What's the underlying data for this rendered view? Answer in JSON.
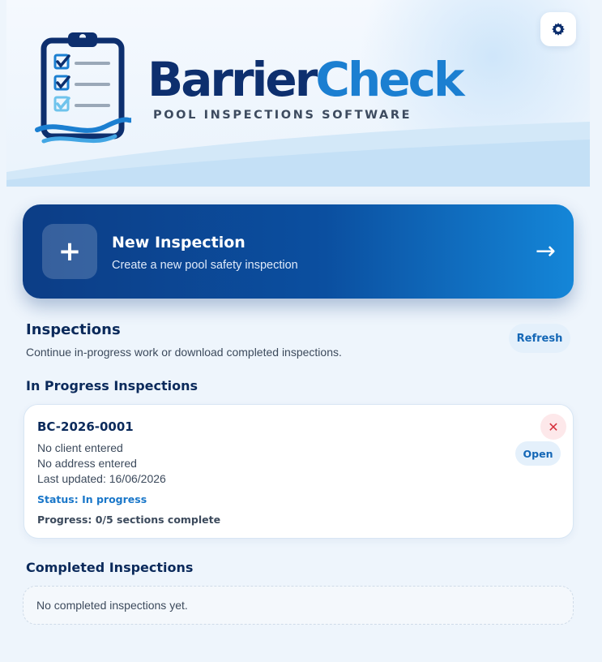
{
  "header": {
    "brand_part1": "Barrier",
    "brand_part2": "Check",
    "tagline": "POOL INSPECTIONS SOFTWARE",
    "settings_icon": "gear-icon",
    "logo_icon": "clipboard-checklist-icon"
  },
  "new_inspection": {
    "plus": "+",
    "title": "New Inspection",
    "subtitle": "Create a new pool safety inspection",
    "arrow": "→"
  },
  "inspections": {
    "title": "Inspections",
    "subtitle": "Continue in-progress work or download completed inspections.",
    "refresh_label": "Refresh"
  },
  "in_progress": {
    "title": "In Progress Inspections",
    "items": [
      {
        "id": "BC-2026-0001",
        "client": "No client entered",
        "address": "No address entered",
        "updated": "Last updated: 16/06/2026",
        "status": "Status: In progress",
        "progress": "Progress: 0/5 sections complete",
        "delete_label": "✕",
        "open_label": "Open"
      }
    ]
  },
  "completed": {
    "title": "Completed Inspections",
    "empty_text": "No completed inspections yet."
  },
  "colors": {
    "brand_dark": "#0d2f6e",
    "brand_accent": "#1b7fd1",
    "status_blue": "#1a77c9",
    "danger": "#d6303c"
  }
}
